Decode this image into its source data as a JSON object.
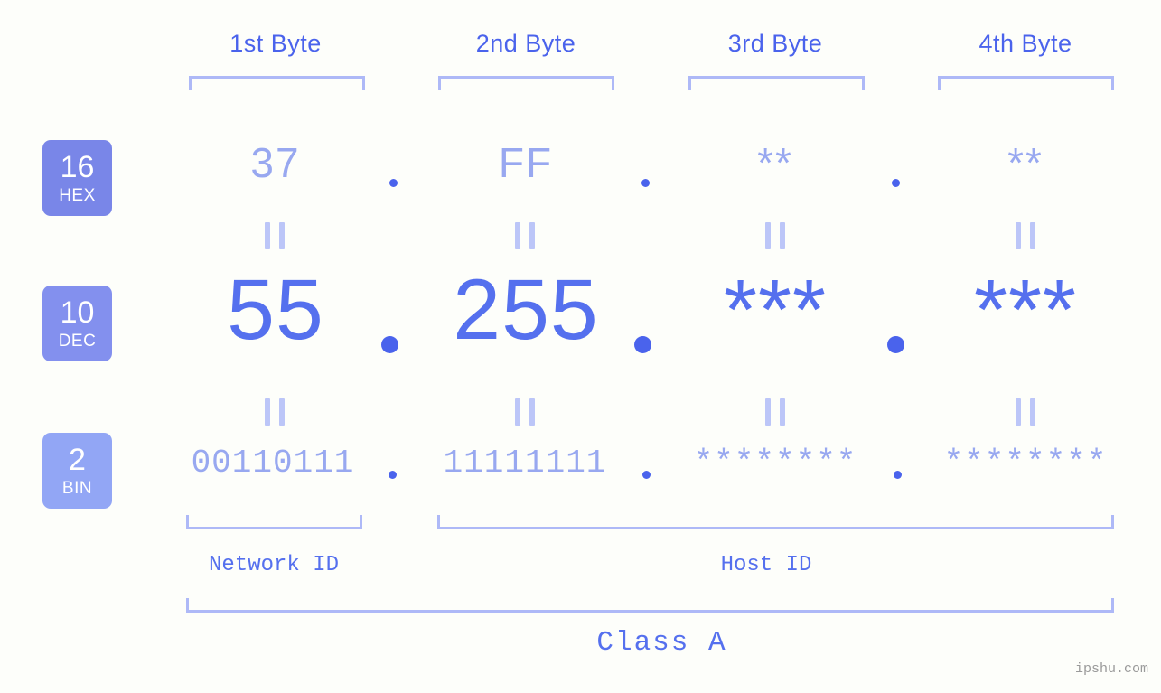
{
  "background_color": "#fdfefa",
  "colors": {
    "primary": "#4a63ec",
    "dec_value": "#5570ee",
    "light": "#98a8f0",
    "bracket": "#aeb9f7",
    "eq_mark": "#bcc6f8",
    "badge_hex": "#7986e8",
    "badge_dec": "#8390ee",
    "badge_bin": "#92a6f5",
    "watermark": "#9a9a9a"
  },
  "headers": [
    {
      "label": "1st Byte"
    },
    {
      "label": "2nd Byte"
    },
    {
      "label": "3rd Byte"
    },
    {
      "label": "4th Byte"
    }
  ],
  "rows": [
    {
      "id": "hex",
      "badge": {
        "base": "16",
        "name": "HEX"
      },
      "values": [
        "37",
        "FF",
        "**",
        "**"
      ],
      "separator": "."
    },
    {
      "id": "dec",
      "badge": {
        "base": "10",
        "name": "DEC"
      },
      "values": [
        "55",
        "255",
        "***",
        "***"
      ],
      "separator": "."
    },
    {
      "id": "bin",
      "badge": {
        "base": "2",
        "name": "BIN"
      },
      "values": [
        "00110111",
        "11111111",
        "********",
        "********"
      ],
      "separator": "."
    }
  ],
  "equals_marker": "=",
  "footer": {
    "network_id_label": "Network ID",
    "host_id_label": "Host ID",
    "class_label": "Class A",
    "watermark": "ipshu.com"
  }
}
